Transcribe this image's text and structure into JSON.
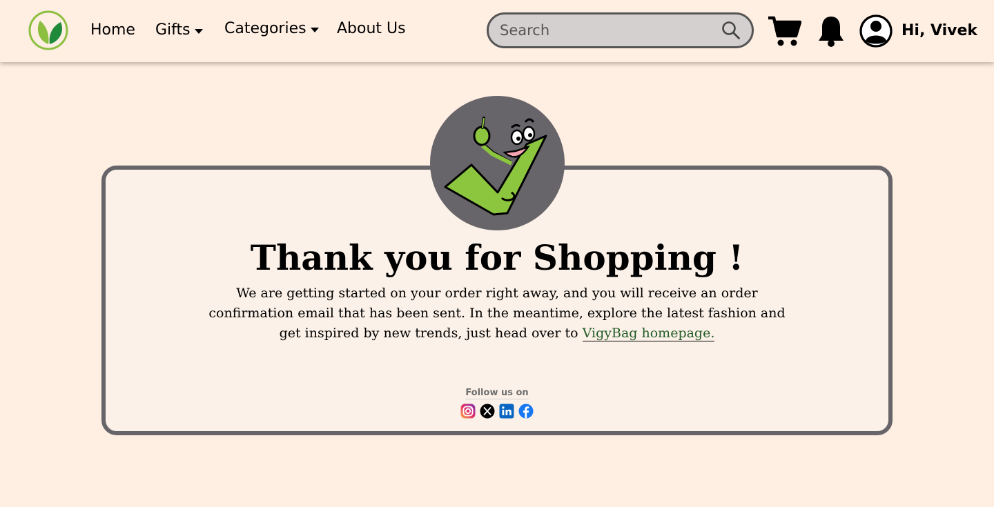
{
  "nav": {
    "home": "Home",
    "gifts": "Gifts",
    "categories": "Categories",
    "about": "About Us"
  },
  "search": {
    "placeholder": "Search"
  },
  "user": {
    "greeting": "Hi, Vivek"
  },
  "icons": [
    "logo-icon",
    "search-icon",
    "cart-icon",
    "bell-icon",
    "user-avatar-icon",
    "instagram-icon",
    "x-icon",
    "linkedin-icon",
    "facebook-icon",
    "check-mascot-icon"
  ],
  "colors": {
    "background": "#ffeee2",
    "card": "#fcf1e8",
    "card_border": "#676569",
    "link": "#215a25",
    "mascot": "#8cc63f"
  },
  "confirmation": {
    "title": "Thank you for Shopping !",
    "message": "We are getting started on your order right away, and you will receive an order confirmation email that has been sent. In the meantime, explore the latest fashion and get inspired by new trends, just head over to",
    "link_text": "VigyBag homepage."
  },
  "social": {
    "follow_label": "Follow us on"
  }
}
